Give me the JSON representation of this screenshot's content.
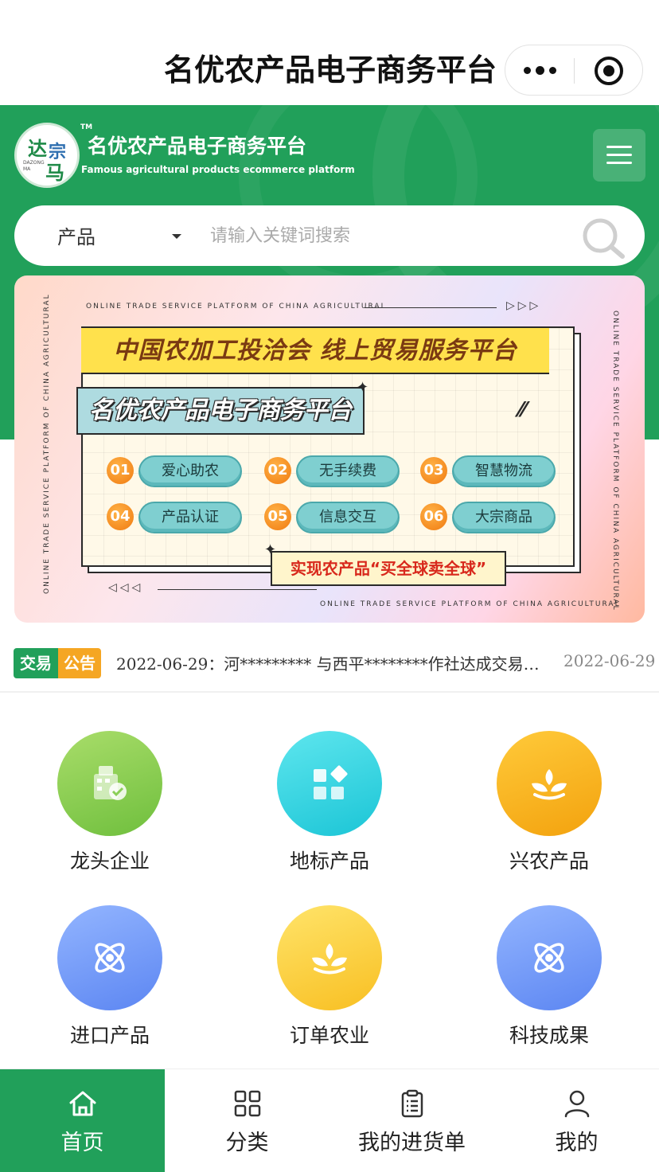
{
  "titlebar": {
    "title": "名优农产品电子商务平台"
  },
  "header": {
    "logo": {
      "line1": "达",
      "line2": "宗",
      "line3": "马",
      "sub": "DAZONG MA",
      "tm": "TM"
    },
    "brand_name": "名优农产品电子商务平台",
    "brand_en": "Famous agricultural products ecommerce platform",
    "menu_icon": "hamburger-menu-icon"
  },
  "search": {
    "category": "产品",
    "placeholder": "请输入关键词搜索",
    "icon": "search-icon"
  },
  "banner": {
    "en_text": "ONLINE TRADE SERVICE PLATFORM OF CHINA AGRICULTURAL",
    "arrows_right": "▷▷▷",
    "arrows_left": "◁◁◁",
    "title1": "中国农加工投洽会 线上贸易服务平台",
    "title2": "名优农产品电子商务平台",
    "features": [
      {
        "num": "01",
        "label": "爱心助农"
      },
      {
        "num": "02",
        "label": "无手续费"
      },
      {
        "num": "03",
        "label": "智慧物流"
      },
      {
        "num": "04",
        "label": "产品认证"
      },
      {
        "num": "05",
        "label": "信息交互"
      },
      {
        "num": "06",
        "label": "大宗商品"
      }
    ],
    "slogan": "实现农产品“买全球卖全球”"
  },
  "notice": {
    "tag_a": "交易",
    "tag_b": "公告",
    "text": "2022-06-29：河********* 与西平********作社达成交易…",
    "date": "2022-06-29"
  },
  "grid": [
    {
      "label": "龙头企业",
      "icon": "enterprise-building-icon",
      "color": "#7cc646"
    },
    {
      "label": "地标产品",
      "icon": "apps-grid-icon",
      "color": "#2ccfdc"
    },
    {
      "label": "兴农产品",
      "icon": "wheat-sprout-icon",
      "color": "#f6ad17"
    },
    {
      "label": "进口产品",
      "icon": "atom-icon",
      "color": "#6a90f5"
    },
    {
      "label": "订单农业",
      "icon": "wheat-sprout-icon",
      "color": "#fbc935"
    },
    {
      "label": "科技成果",
      "icon": "atom-icon",
      "color": "#6a90f5"
    }
  ],
  "tabbar": {
    "items": [
      {
        "label": "首页",
        "icon": "home-icon",
        "active": true
      },
      {
        "label": "分类",
        "icon": "category-grid-icon",
        "active": false
      },
      {
        "label": "我的进货单",
        "icon": "clipboard-list-icon",
        "active": false
      },
      {
        "label": "我的",
        "icon": "user-icon",
        "active": false
      }
    ],
    "active_color": "#21a05a"
  }
}
